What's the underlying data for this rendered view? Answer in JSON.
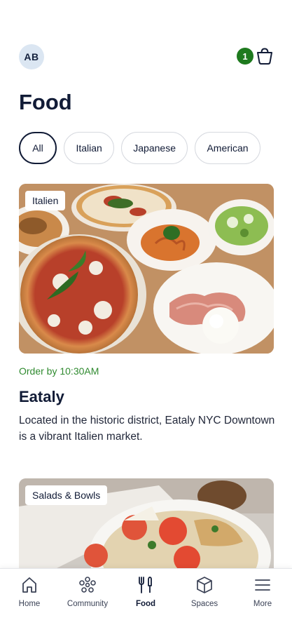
{
  "header": {
    "avatar_initials": "AB",
    "cart_count": "1",
    "cart_icon": "cart-icon"
  },
  "page_title": "Food",
  "filters": {
    "chips": [
      "All",
      "Italian",
      "Japanese",
      "American"
    ],
    "selected": "All"
  },
  "cards": [
    {
      "tag": "Italien",
      "order_by": "Order by 10:30AM",
      "name": "Eataly",
      "description": "Located in the historic district, Eataly NYC Downtown is a vibrant Italien market."
    },
    {
      "tag": "Salads & Bowls"
    }
  ],
  "bottom_nav": {
    "items": [
      {
        "label": "Home",
        "icon": "home-icon"
      },
      {
        "label": "Community",
        "icon": "community-icon"
      },
      {
        "label": "Food",
        "icon": "fork-knife-icon"
      },
      {
        "label": "Spaces",
        "icon": "cube-icon"
      },
      {
        "label": "More",
        "icon": "menu-icon"
      }
    ],
    "active": "Food"
  },
  "colors": {
    "accent": "#1e7a1e",
    "text": "#111b36",
    "order_green": "#2f8a2f"
  }
}
